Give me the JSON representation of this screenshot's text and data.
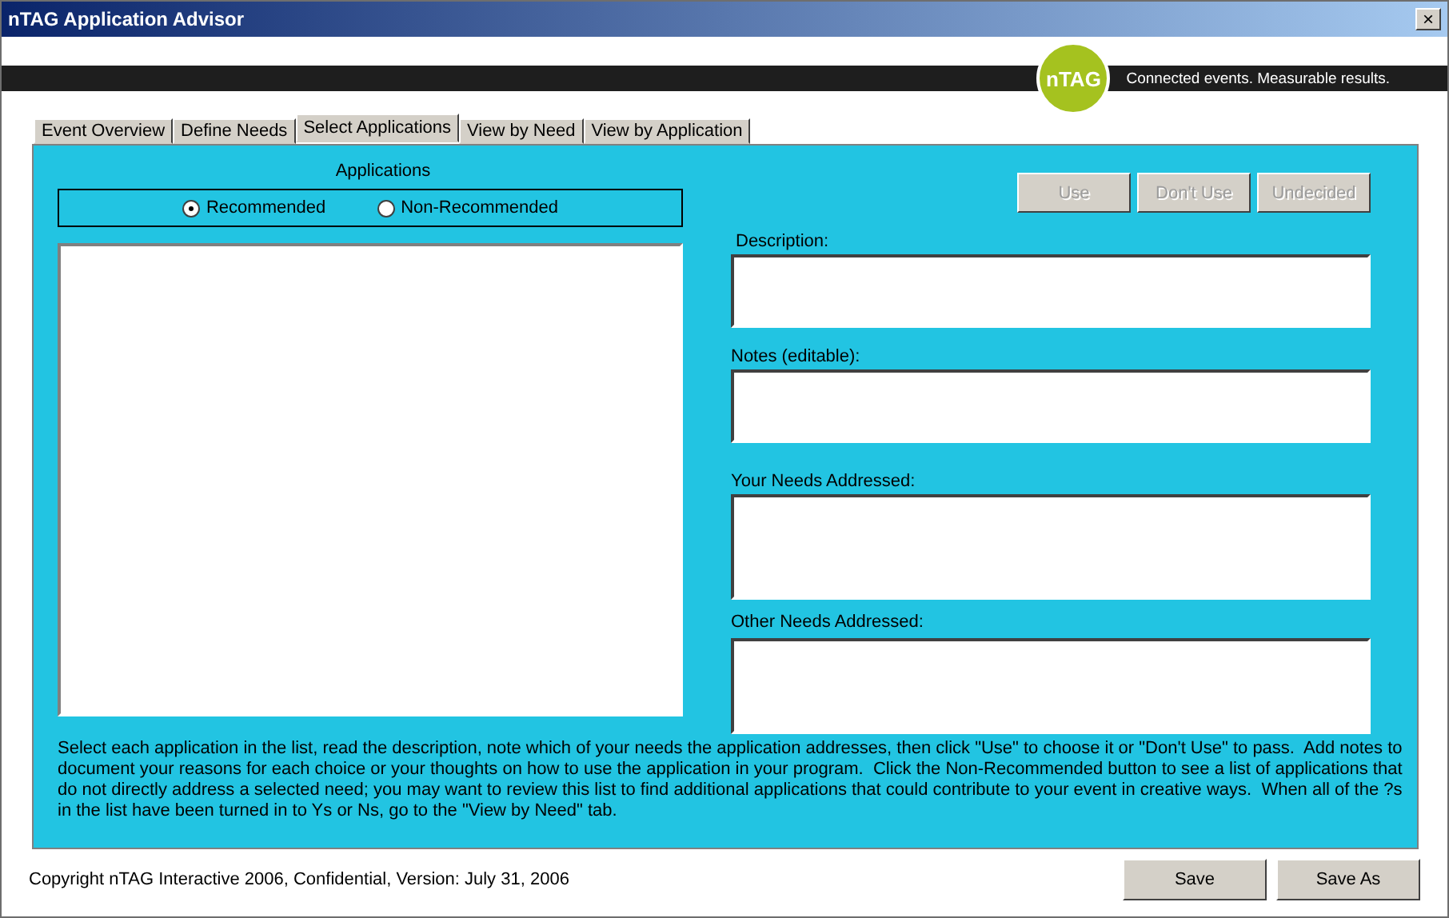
{
  "window": {
    "title": "nTAG Application Advisor",
    "close": "×"
  },
  "banner": {
    "logo": "nTAG",
    "tagline": "Connected events. Measurable results."
  },
  "tabs": [
    {
      "label": "Event Overview",
      "selected": false
    },
    {
      "label": "Define Needs",
      "selected": false
    },
    {
      "label": "Select Applications",
      "selected": true
    },
    {
      "label": "View by Need",
      "selected": false
    },
    {
      "label": "View by Application",
      "selected": false
    }
  ],
  "applications": {
    "heading": "Applications",
    "filters": [
      {
        "label": "Recommended",
        "selected": true
      },
      {
        "label": "Non-Recommended",
        "selected": false
      }
    ]
  },
  "actions": [
    {
      "label": "Use",
      "disabled": true
    },
    {
      "label": "Don't Use",
      "disabled": true
    },
    {
      "label": "Undecided",
      "disabled": true
    }
  ],
  "fields": [
    {
      "label": "Description:"
    },
    {
      "label": "Notes (editable):"
    },
    {
      "label": "Your Needs Addressed:"
    },
    {
      "label": "Other Needs Addressed:"
    }
  ],
  "instructions": "Select each application in the list, read the description, note which of your needs the application addresses, then click \"Use\" to choose it or \"Don't Use\" to pass.  Add notes to document your reasons for each choice or your thoughts on how to use the application in your program.  Click the Non-Recommended button to see a list of applications that do not directly address a selected need; you may want to review this list to find additional applications that could contribute to your event in creative ways.  When all of the ?s in the list have been turned in to Ys or Ns, go to the \"View by Need\" tab.",
  "footer": {
    "copyright": "Copyright nTAG Interactive 2006, Confidential, Version: July 31, 2006",
    "buttons": [
      "Save",
      "Save As"
    ]
  }
}
